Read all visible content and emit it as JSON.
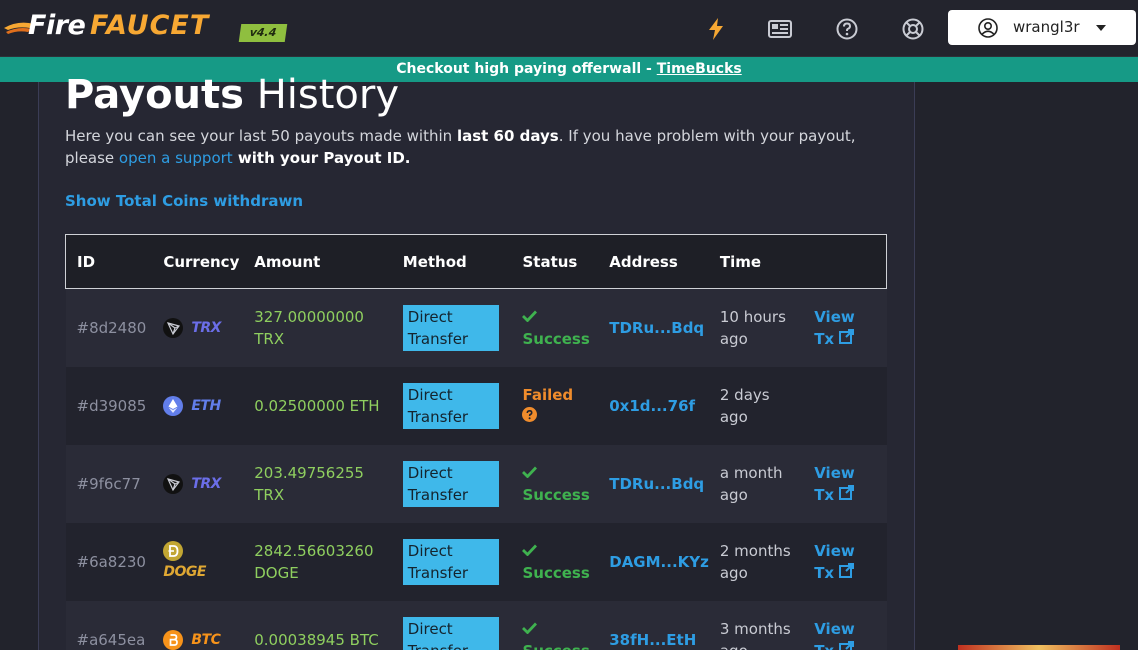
{
  "brand": {
    "fire": "Fire",
    "faucet": "FAUCET",
    "version": "v4.4"
  },
  "nav": {
    "icons": [
      "lightning-icon",
      "newspaper-icon",
      "help-icon",
      "lifebuoy-icon"
    ],
    "username": "wrangl3r"
  },
  "announcement": {
    "text": "Checkout high paying offerwall - ",
    "link": "TimeBucks"
  },
  "page": {
    "title_bold": "Payouts",
    "title_light": "History",
    "intro_1": "Here you can see your last 50 payouts made within ",
    "intro_bold": "last 60 days",
    "intro_2": ". If you have problem with your payout, please ",
    "intro_link": "open a support",
    "intro_3": " with your Payout ID.",
    "show_total": "Show Total Coins withdrawn"
  },
  "table": {
    "headers": {
      "id": "ID",
      "currency": "Currency",
      "amount": "Amount",
      "method": "Method",
      "status": "Status",
      "address": "Address",
      "time": "Time"
    },
    "rows": [
      {
        "id": "#8d2480",
        "currency": "TRX",
        "amount_1": "327.00000000",
        "amount_2": "TRX",
        "method_1": "Direct",
        "method_2": "Transfer",
        "status": "Success",
        "address": "TDRu...Bdq",
        "time_1": "10 hours",
        "time_2": "ago",
        "view_1": "View",
        "view_2": "Tx"
      },
      {
        "id": "#d39085",
        "currency": "ETH",
        "amount_1": "0.02500000 ETH",
        "amount_2": "",
        "method_1": "Direct",
        "method_2": "Transfer",
        "status": "Failed",
        "address": "0x1d...76f",
        "time_1": "2 days",
        "time_2": "ago",
        "view_1": "",
        "view_2": ""
      },
      {
        "id": "#9f6c77",
        "currency": "TRX",
        "amount_1": "203.49756255",
        "amount_2": "TRX",
        "method_1": "Direct",
        "method_2": "Transfer",
        "status": "Success",
        "address": "TDRu...Bdq",
        "time_1": "a month",
        "time_2": "ago",
        "view_1": "View",
        "view_2": "Tx"
      },
      {
        "id": "#6a8230",
        "currency": "DOGE",
        "amount_1": "2842.56603260",
        "amount_2": "DOGE",
        "method_1": "Direct",
        "method_2": "Transfer",
        "status": "Success",
        "address": "DAGM...KYz",
        "time_1": "2 months",
        "time_2": "ago",
        "view_1": "View",
        "view_2": "Tx"
      },
      {
        "id": "#a645ea",
        "currency": "BTC",
        "amount_1": "0.00038945 BTC",
        "amount_2": "",
        "method_1": "Direct",
        "method_2": "Transfer",
        "status": "Success",
        "address": "38fH...EtH",
        "time_1": "3 months",
        "time_2": "ago",
        "view_1": "View",
        "view_2": "Tx"
      }
    ]
  },
  "colors": {
    "accent": "#2e9de3",
    "announce_bg": "#169a86",
    "success": "#3fb24f",
    "failed": "#f08c2c",
    "amount": "#8fcf5f",
    "method_badge": "#3fb8ea",
    "trx": "#6b6ee8",
    "eth": "#627eea",
    "doge": "#c2a633",
    "btc": "#f7931a"
  }
}
